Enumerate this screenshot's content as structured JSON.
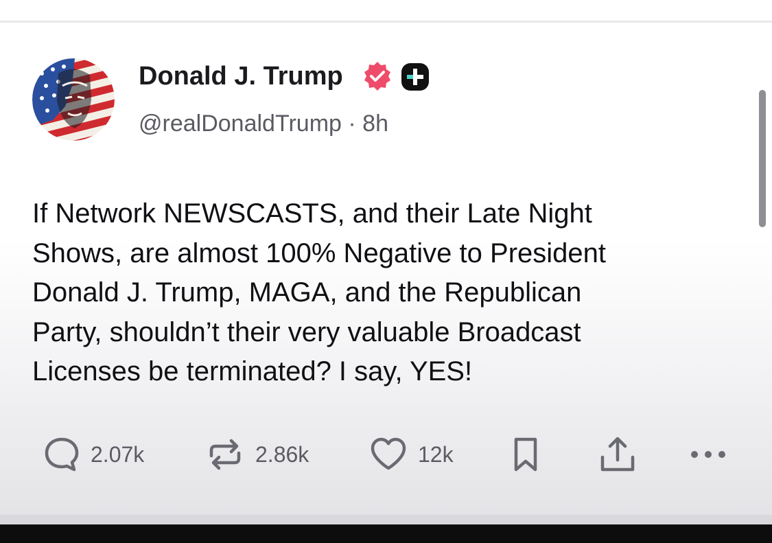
{
  "post": {
    "author": {
      "display_name": "Donald J. Trump",
      "handle": "@realDonaldTrump",
      "separator": "·",
      "time_ago": "8h",
      "avatar_icon": "flag-portrait-avatar",
      "verified_icon": "verified-badge-icon",
      "plus_icon": "plus-badge-icon"
    },
    "text_lines": [
      "If Network NEWSCASTS, and their Late Night",
      "Shows, are almost 100% Negative to President",
      "Donald J. Trump, MAGA, and the Republican",
      "Party, shouldn’t their very valuable Broadcast",
      "Licenses be terminated? I say, YES!"
    ],
    "actions": {
      "replies": "2.07k",
      "reposts": "2.86k",
      "likes": "12k"
    }
  },
  "colors": {
    "verified_badge": "#ee4c6a",
    "plus_badge": "#111111",
    "plus_accent": "#4bd3c6",
    "text_primary": "#101014",
    "text_secondary": "#5a5a62",
    "icon_gray": "#6a6a72"
  }
}
